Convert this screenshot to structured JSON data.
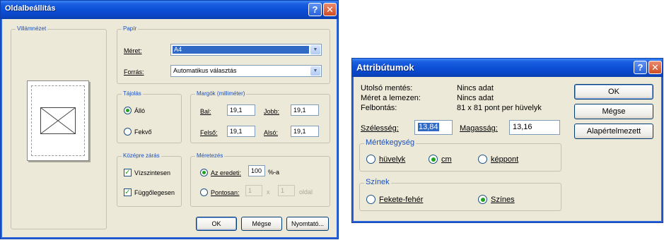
{
  "page_setup": {
    "title": "Oldalbeállítás",
    "preview_group": "Villámnézet",
    "paper": {
      "legend": "Papír",
      "size_label": "Méret:",
      "size_value": "A4",
      "source_label": "Forrás:",
      "source_value": "Automatikus választás"
    },
    "orientation": {
      "legend": "Tájolás",
      "portrait": "Álló",
      "landscape": "Fekvő",
      "selected": "portrait"
    },
    "margins": {
      "legend": "Margók (milliméter)",
      "left_label": "Bal:",
      "left_value": "19,1",
      "right_label": "Jobb:",
      "right_value": "19,1",
      "top_label": "Felső:",
      "top_value": "19,1",
      "bottom_label": "Alsó:",
      "bottom_value": "19,1"
    },
    "centering": {
      "legend": "Középre zárás",
      "horizontal": "Vízszintesen",
      "vertical": "Függőlegesen",
      "horizontal_checked": true,
      "vertical_checked": true
    },
    "scaling": {
      "legend": "Méretezés",
      "original_label": "Az eredeti:",
      "original_value": "100",
      "original_unit": "%-a",
      "fit_label": "Pontosan:",
      "fit_wide": "1",
      "fit_x": "x",
      "fit_tall": "1",
      "fit_unit": "oldal",
      "selected": "original"
    },
    "buttons": {
      "ok": "OK",
      "cancel": "Mégse",
      "printer": "Nyomtató..."
    }
  },
  "attributes": {
    "title": "Attribútumok",
    "info": [
      {
        "label": "Utolsó mentés:",
        "value": "Nincs adat"
      },
      {
        "label": "Méret a lemezen:",
        "value": "Nincs adat"
      },
      {
        "label": "Felbontás:",
        "value": "81 x 81 pont per hüvelyk"
      }
    ],
    "width_label": "Szélesség:",
    "width_value": "13,84",
    "height_label": "Magasság:",
    "height_value": "13,16",
    "units": {
      "legend": "Mértékegység",
      "inches": "hüvelyk",
      "cm": "cm",
      "pixels": "képpont",
      "selected": "cm"
    },
    "colors": {
      "legend": "Színek",
      "bw": "Fekete-fehér",
      "color": "Színes",
      "selected": "color"
    },
    "buttons": {
      "ok": "OK",
      "cancel": "Mégse",
      "default": "Alapértelmezett"
    }
  },
  "colors": {
    "accent": "#0c4fd6",
    "dialog_bg": "#ece9d8",
    "legend_text": "#1a4fbd",
    "selection": "#316ac5"
  }
}
